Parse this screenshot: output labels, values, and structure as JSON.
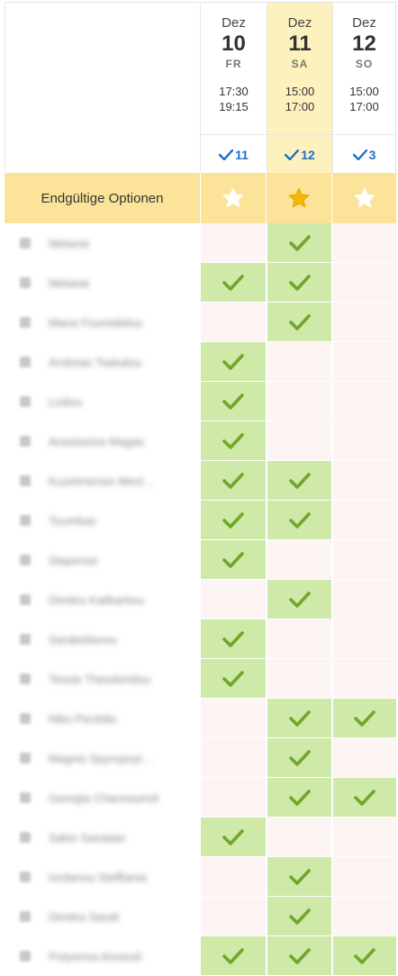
{
  "columns": [
    {
      "month": "Dez",
      "day": "10",
      "weekday": "FR",
      "start": "17:30",
      "end": "19:15",
      "count": "11",
      "selected": false
    },
    {
      "month": "Dez",
      "day": "11",
      "weekday": "SA",
      "start": "15:00",
      "end": "17:00",
      "count": "12",
      "selected": true
    },
    {
      "month": "Dez",
      "day": "12",
      "weekday": "SO",
      "start": "15:00",
      "end": "17:00",
      "count": "3",
      "selected": false
    }
  ],
  "final_options": {
    "label": "Endgültige Optionen",
    "stars": [
      false,
      true,
      false
    ]
  },
  "colors": {
    "yes_bg": "#cfe9a8",
    "no_bg": "#fdf4f4",
    "check": "#6fa72a",
    "selected_col": "#fdf1bd",
    "final_row": "#fce39a",
    "count_blue": "#1e6fc8",
    "star_gold": "#f5b800"
  },
  "participants": [
    {
      "name": "Melanie",
      "votes": [
        false,
        true,
        false
      ]
    },
    {
      "name": "Melanie",
      "votes": [
        true,
        true,
        false
      ]
    },
    {
      "name": "Maria Fountalidou",
      "votes": [
        false,
        true,
        false
      ]
    },
    {
      "name": "Andreas Tsakalou",
      "votes": [
        true,
        false,
        false
      ]
    },
    {
      "name": "Lioliou",
      "votes": [
        true,
        false,
        false
      ]
    },
    {
      "name": "Anastasios Magas",
      "votes": [
        true,
        false,
        false
      ]
    },
    {
      "name": "Kuzelmensis Mesl…",
      "votes": [
        true,
        true,
        false
      ]
    },
    {
      "name": "Toumbas",
      "votes": [
        true,
        true,
        false
      ]
    },
    {
      "name": "Stapenas",
      "votes": [
        true,
        false,
        false
      ]
    },
    {
      "name": "Dimitra Katikartiou",
      "votes": [
        false,
        true,
        false
      ]
    },
    {
      "name": "Sarakelianou",
      "votes": [
        true,
        false,
        false
      ]
    },
    {
      "name": "Tessie Theodoridou",
      "votes": [
        true,
        false,
        false
      ]
    },
    {
      "name": "Niko Pectidis",
      "votes": [
        false,
        true,
        true
      ]
    },
    {
      "name": "Magnis Spyropoyl…",
      "votes": [
        false,
        true,
        false
      ]
    },
    {
      "name": "Georgia Chansounoli",
      "votes": [
        false,
        true,
        true
      ]
    },
    {
      "name": "Sakis Sanaiias",
      "votes": [
        true,
        false,
        false
      ]
    },
    {
      "name": "Iordanou Steffiania",
      "votes": [
        false,
        true,
        false
      ]
    },
    {
      "name": "Dimitra Sarali",
      "votes": [
        false,
        true,
        false
      ]
    },
    {
      "name": "Potyenna Anoissil",
      "votes": [
        true,
        true,
        true
      ]
    }
  ]
}
